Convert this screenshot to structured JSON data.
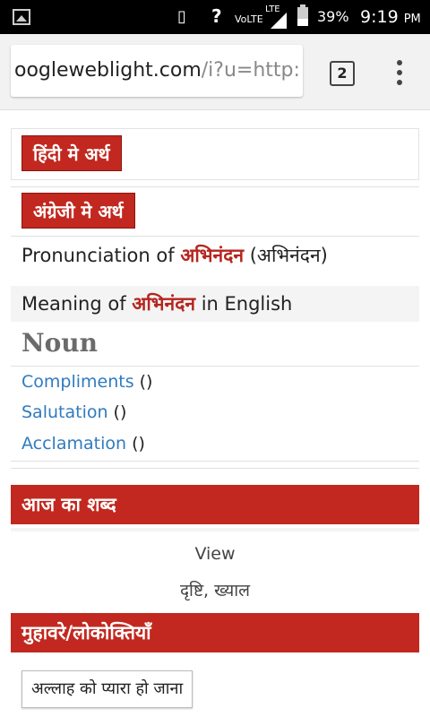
{
  "status_bar": {
    "network_label": "VoLTE",
    "lte_label": "LTE",
    "battery": "39%",
    "time": "9:19",
    "ampm": "PM"
  },
  "browser": {
    "url_host": "oogleweblight.com",
    "url_rest": "/i?u=http:",
    "tab_count": "2"
  },
  "content": {
    "hindi_meaning_button": "हिंदी मे अर्थ",
    "english_meaning_button": "अंग्रेजी मे अर्थ",
    "pronunciation_prefix": "Pronunciation of ",
    "pronunciation_word": "अभिनंदन",
    "pronunciation_suffix": " (अभिनंदन)",
    "meaning_prefix": "Meaning of ",
    "meaning_word": "अभिनंदन",
    "meaning_suffix": " in English",
    "part_of_speech": "Noun",
    "synonyms": [
      {
        "word": "Compliments",
        "extra": " ()"
      },
      {
        "word": "Salutation",
        "extra": " ()"
      },
      {
        "word": "Acclamation",
        "extra": " ()"
      }
    ],
    "word_of_day_header": "आज का शब्द",
    "word_of_day_english": "View",
    "word_of_day_hindi": "दृष्टि, ख्याल",
    "idioms_header": "मुहावरे/लोकोक्तियाँ",
    "idiom": "अल्लाह को प्यारा हो जाना"
  },
  "colors": {
    "accent_red": "#c2281f",
    "link_blue": "#2f7bbf"
  }
}
